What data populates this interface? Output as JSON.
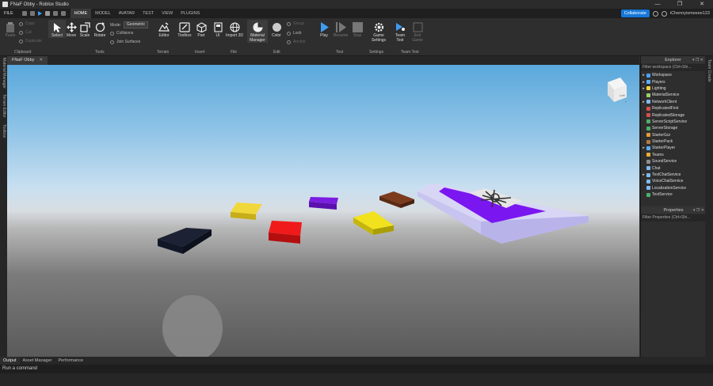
{
  "title": "FNaF Obby - Roblox Studio",
  "window_controls": [
    "—",
    "❐",
    "✕"
  ],
  "menu": {
    "file": "FILE",
    "tabs": [
      "HOME",
      "MODEL",
      "AVATAR",
      "TEST",
      "VIEW",
      "PLUGINS"
    ],
    "active_tab": "HOME",
    "collaborate": "Collaborate",
    "username": "iChennyismeeee123"
  },
  "ribbon": {
    "clipboard": {
      "paste": "Paste",
      "copy": "Copy",
      "cut": "Cut",
      "duplicate": "Duplicate",
      "group": "Clipboard"
    },
    "tools": {
      "select": "Select",
      "move": "Move",
      "scale": "Scale",
      "rotate": "Rotate",
      "mode_label": "Mode:",
      "mode_value": "Geometric",
      "collisions": "Collisions",
      "join_surfaces": "Join Surfaces",
      "group": "Tools"
    },
    "terrain": {
      "editor": "Editor",
      "group": "Terrain"
    },
    "insert": {
      "toolbox": "Toolbox",
      "part": "Part",
      "ui": "UI",
      "group": "Insert"
    },
    "file": {
      "import3d": "Import 3D",
      "group": "File"
    },
    "edit": {
      "material_manager": "Material Manager",
      "color": "Color",
      "group_btn": "Group",
      "lock": "Lock",
      "anchor": "Anchor",
      "group": "Edit"
    },
    "test": {
      "play": "Play",
      "resume": "Resume",
      "stop": "Stop",
      "group": "Test"
    },
    "settings": {
      "game_settings": "Game Settings",
      "group": "Settings"
    },
    "team_test": {
      "team_test": "Team Test",
      "exit_game": "Exit Game",
      "group": "Team Test"
    }
  },
  "left_tabs": [
    "Material Manager",
    "Terrain Editor",
    "Toolbox"
  ],
  "right_tabs": [
    "Team Create"
  ],
  "document_tab": {
    "name": "FNaF Obby",
    "close": "✕"
  },
  "viewcube_label": "Left",
  "explorer": {
    "title": "Explorer",
    "filter": "Filter workspace (Ctrl+Shi...",
    "items": [
      {
        "name": "Workspace",
        "arrow": "▸",
        "color": "#4aa3ff"
      },
      {
        "name": "Players",
        "arrow": "▸",
        "color": "#5ab0ff"
      },
      {
        "name": "Lighting",
        "arrow": "▸",
        "color": "#f5d23c"
      },
      {
        "name": "MaterialService",
        "arrow": "",
        "color": "#9ad06b"
      },
      {
        "name": "NetworkClient",
        "arrow": "▸",
        "color": "#7fbaf0"
      },
      {
        "name": "ReplicatedFirst",
        "arrow": "",
        "color": "#d84f4f"
      },
      {
        "name": "ReplicatedStorage",
        "arrow": "",
        "color": "#d84f4f"
      },
      {
        "name": "ServerScriptService",
        "arrow": "",
        "color": "#4fae6a"
      },
      {
        "name": "ServerStorage",
        "arrow": "",
        "color": "#4fae6a"
      },
      {
        "name": "StarterGui",
        "arrow": "",
        "color": "#e39a3c"
      },
      {
        "name": "StarterPack",
        "arrow": "",
        "color": "#b07a45"
      },
      {
        "name": "StarterPlayer",
        "arrow": "▸",
        "color": "#5ab0ff"
      },
      {
        "name": "Teams",
        "arrow": "",
        "color": "#e3b03c"
      },
      {
        "name": "SoundService",
        "arrow": "",
        "color": "#8e8e8e"
      },
      {
        "name": "Chat",
        "arrow": "",
        "color": "#7fbaf0"
      },
      {
        "name": "TextChatService",
        "arrow": "▸",
        "color": "#7fbaf0"
      },
      {
        "name": "VoiceChatService",
        "arrow": "",
        "color": "#7fbaf0"
      },
      {
        "name": "LocalizationService",
        "arrow": "",
        "color": "#7fbaf0"
      },
      {
        "name": "TestService",
        "arrow": "",
        "color": "#4fae6a"
      }
    ]
  },
  "properties": {
    "title": "Properties",
    "filter": "Filter Properties (Ctrl+Shi..."
  },
  "bottom_tabs": [
    "Output",
    "Asset Manager",
    "Performance"
  ],
  "command_bar": "Run a command",
  "colors": {
    "accent": "#1577d8",
    "play": "#3e9cf2"
  }
}
